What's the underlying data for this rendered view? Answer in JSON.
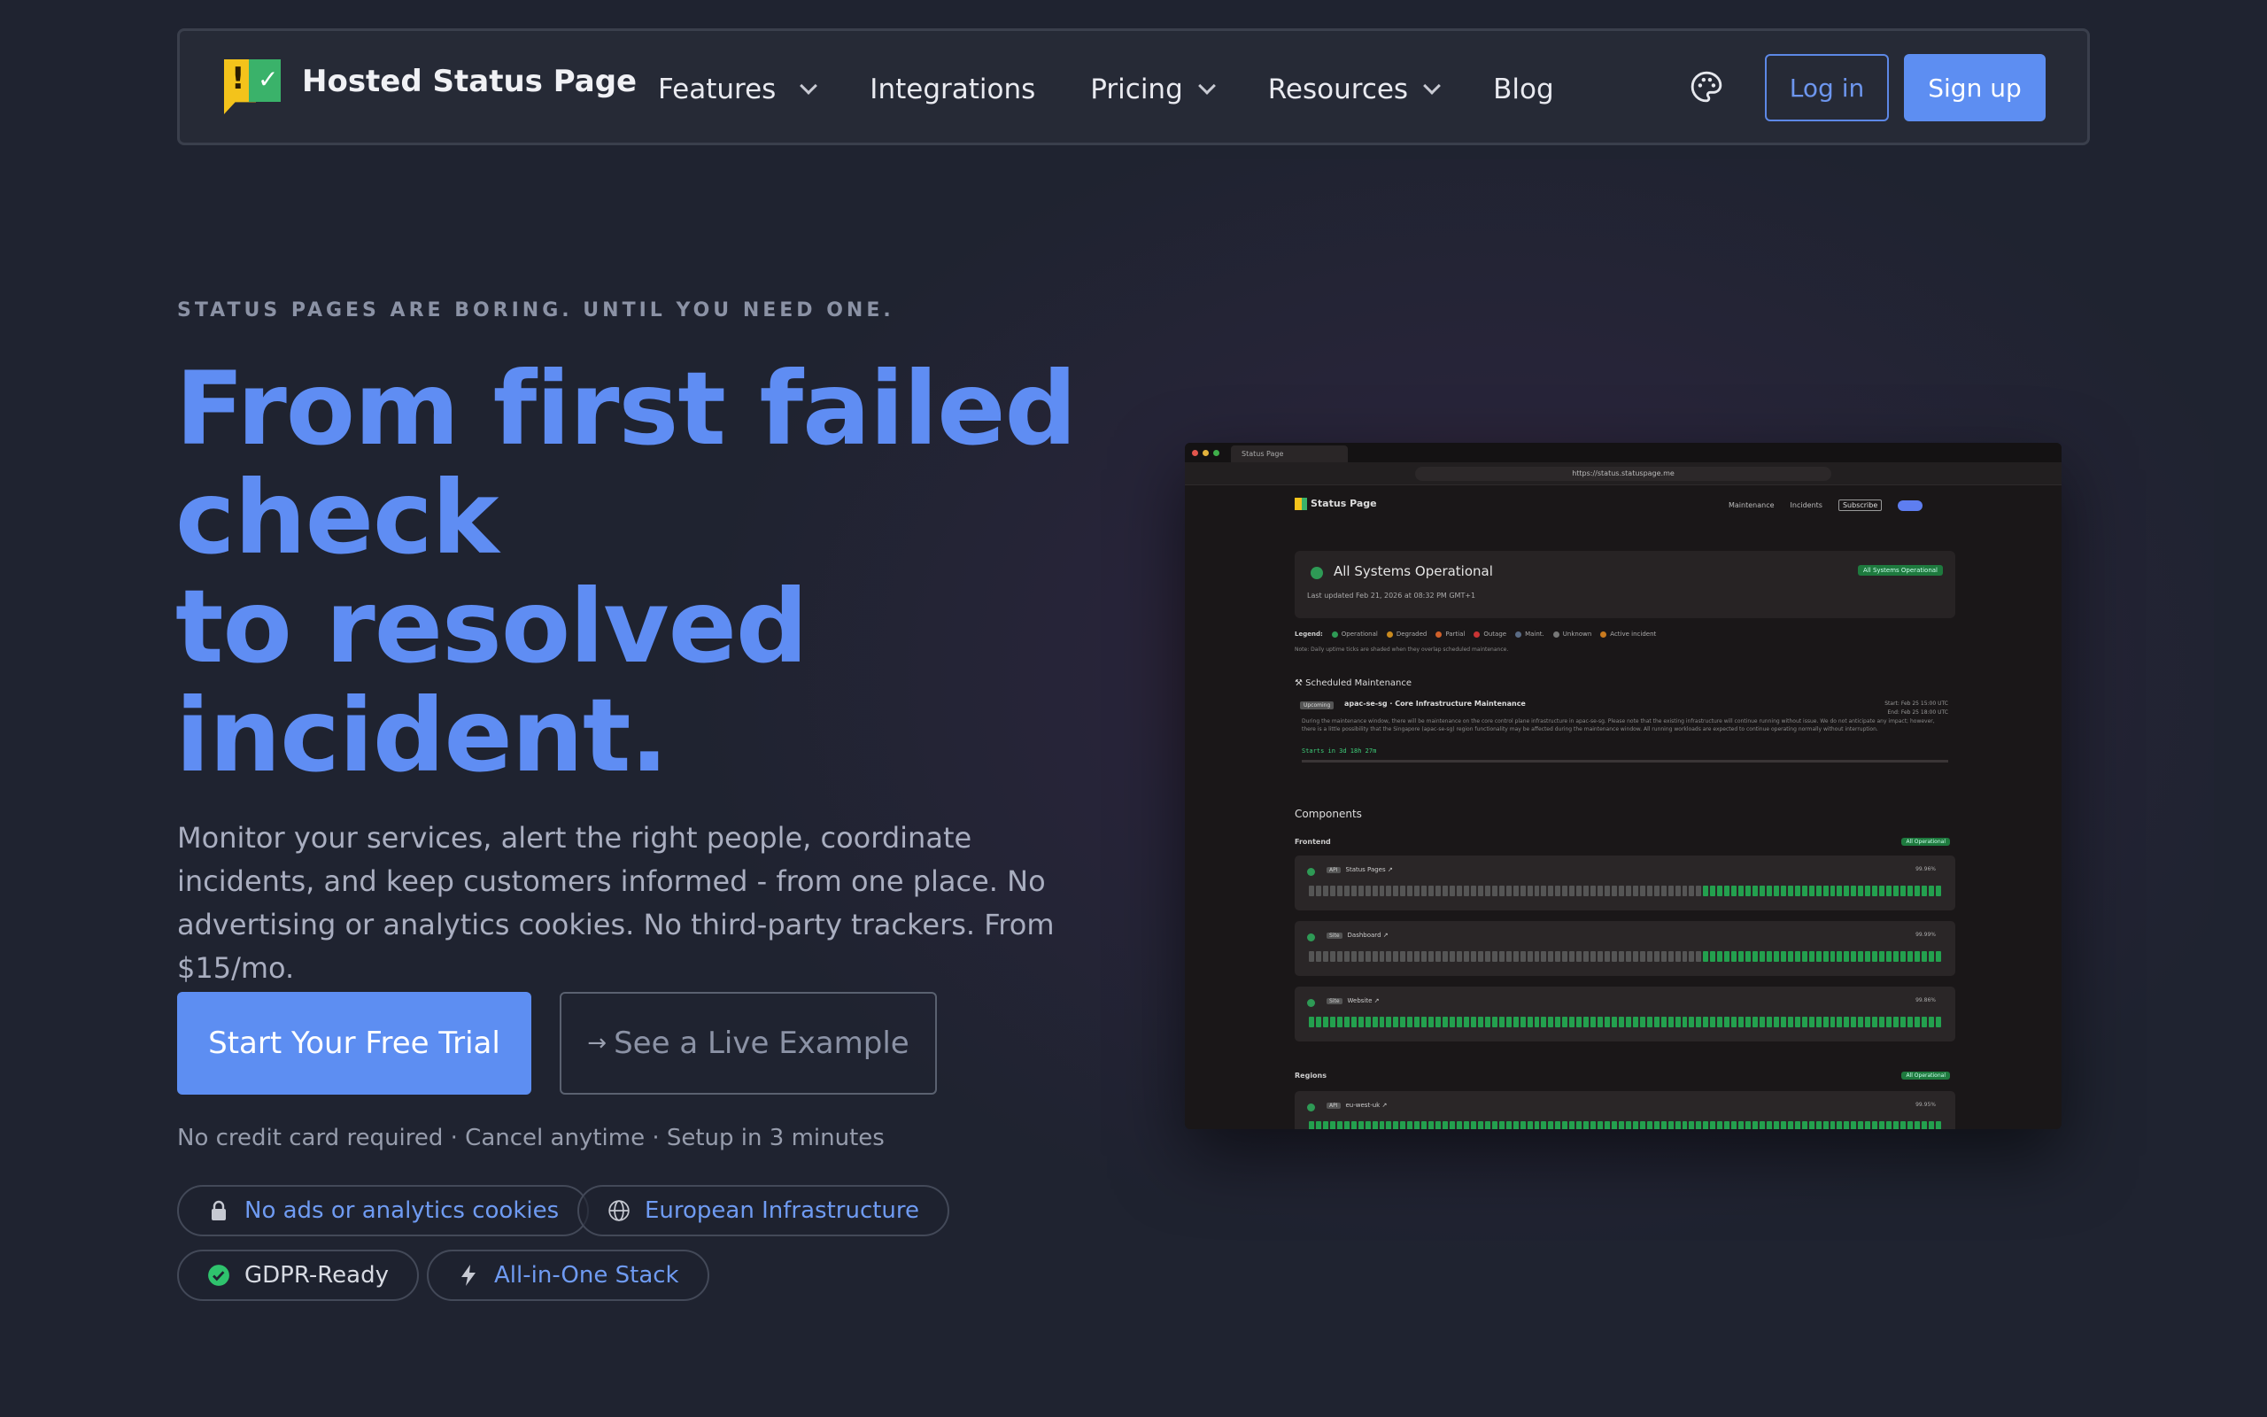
{
  "nav": {
    "brand": "Hosted Status Page",
    "links": [
      "Features",
      "Integrations",
      "Pricing",
      "Resources",
      "Blog"
    ],
    "login": "Log in",
    "signup": "Sign up",
    "theme_icon": "palette-icon"
  },
  "hero": {
    "eyebrow": "STATUS PAGES ARE BORING. UNTIL YOU NEED ONE.",
    "headline_lines": [
      "From first failed",
      "check",
      "to resolved",
      "incident."
    ],
    "subtitle": "Monitor your services, alert the right people, coordinate incidents, and keep customers informed - from one place. No advertising or analytics cookies. No third-party trackers. From $15/mo.",
    "cta_primary": "Start Your Free Trial",
    "cta_secondary": "See a Live Example",
    "fine_print": "No credit card required · Cancel anytime · Setup in 3 minutes",
    "badges": [
      {
        "label": "No ads or analytics cookies",
        "icon": "lock-icon"
      },
      {
        "label": "European Infrastructure",
        "icon": "globe-icon"
      },
      {
        "label": "GDPR-Ready",
        "icon": "check-circle-icon"
      },
      {
        "label": "All-in-One Stack",
        "icon": "bolt-icon"
      }
    ]
  },
  "preview": {
    "tab": "Status Page",
    "url": "https://status.statuspage.me",
    "brand": "Status Page",
    "nav": [
      "Maintenance",
      "Incidents",
      "Subscribe"
    ],
    "status_title": "All Systems Operational",
    "status_updated": "Last updated Feb 21, 2026 at 08:32 PM GMT+1",
    "status_pill": "All Systems Operational",
    "legend_label": "Legend:",
    "legend": [
      "Operational",
      "Degraded",
      "Partial",
      "Outage",
      "Maint.",
      "Unknown",
      "Active incident"
    ],
    "note": "Note: Daily uptime ticks are shaded when they overlap scheduled maintenance.",
    "maintenance_heading": "Scheduled Maintenance",
    "maintenance_tag": "Upcoming",
    "maintenance_title": "apac-se-sg · Core Infrastructure Maintenance",
    "maintenance_start": "Start: Feb 25 15:00 UTC",
    "maintenance_end": "End: Feb 25 18:00 UTC",
    "maintenance_desc": "During the maintenance window, there will be maintenance on the core control plane infrastructure in apac-se-sg. Please note that the existing infrastructure will continue running without issue. We do not anticipate any impact; however, there is a little possibility that the Singapore (apac-se-sg) region functionality may be affected during the maintenance window. All running workloads are expected to continue operating normally without interruption.",
    "maintenance_starts": "Starts in 3d 18h 27m",
    "components_heading": "Components",
    "groups": [
      {
        "name": "Frontend",
        "pill": "All Operational"
      },
      {
        "name": "Regions",
        "pill": "All Operational"
      }
    ],
    "rows": [
      {
        "key": "API",
        "name": "Status Pages",
        "pct": "99.96%"
      },
      {
        "key": "Site",
        "name": "Dashboard",
        "pct": "99.99%"
      },
      {
        "key": "Site",
        "name": "Website",
        "pct": "99.86%"
      },
      {
        "key": "API",
        "name": "eu-west-uk",
        "pct": "99.95%"
      }
    ]
  },
  "colors": {
    "accent": "#5d8ef2",
    "background": "#1f2330",
    "operational": "#23a04e"
  }
}
